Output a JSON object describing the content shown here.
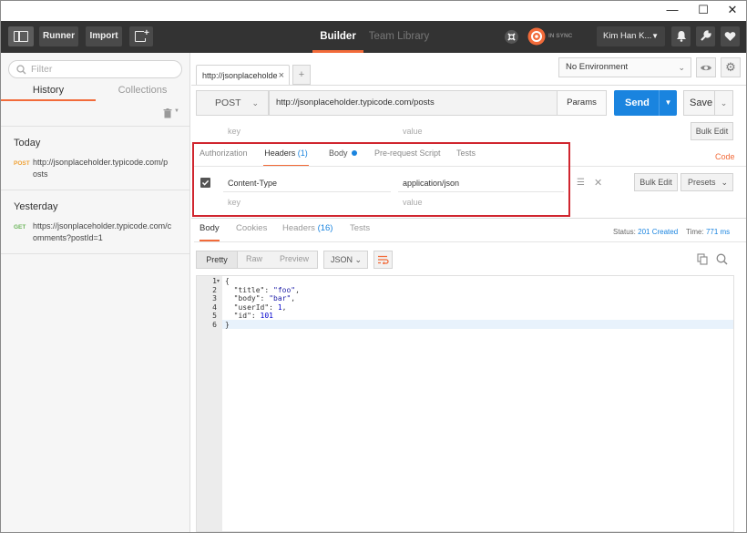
{
  "window": {
    "minimize": "—",
    "maximize": "☐",
    "close": "✕"
  },
  "header": {
    "runner": "Runner",
    "import": "Import",
    "tabs": {
      "builder": "Builder",
      "team_library": "Team Library"
    },
    "sync_status": "IN SYNC",
    "user": "Kim Han K..."
  },
  "sidebar": {
    "filter_placeholder": "Filter",
    "tabs": {
      "history": "History",
      "collections": "Collections"
    },
    "sections": [
      {
        "label": "Today",
        "method": "POST",
        "url_line1": "http://jsonplaceholder.typicode.com/p",
        "url_line2": "osts"
      },
      {
        "label": "Yesterday",
        "method": "GET",
        "url_line1": "https://jsonplaceholder.typicode.com/c",
        "url_line2": "omments?postId=1"
      }
    ]
  },
  "request_tab": {
    "label": "http://jsonplaceholde",
    "close": "×",
    "add": "+"
  },
  "environment": {
    "selected": "No Environment"
  },
  "request": {
    "method": "POST",
    "url": "http://jsonplaceholder.typicode.com/posts",
    "params": "Params",
    "send": "Send",
    "save": "Save"
  },
  "params_row": {
    "key_placeholder": "key",
    "value_placeholder": "value",
    "bulk_edit": "Bulk Edit"
  },
  "request_tabs": {
    "authorization": "Authorization",
    "headers": "Headers",
    "headers_count": "(1)",
    "body": "Body",
    "prerequest": "Pre-request Script",
    "tests": "Tests",
    "code": "Code"
  },
  "headers": {
    "rows": [
      {
        "key": "Content-Type",
        "value": "application/json"
      }
    ],
    "key_placeholder": "key",
    "value_placeholder": "value",
    "bulk_edit": "Bulk Edit",
    "presets": "Presets"
  },
  "response": {
    "tabs": {
      "body": "Body",
      "cookies": "Cookies",
      "headers": "Headers",
      "headers_count": "(16)",
      "tests": "Tests"
    },
    "status_label": "Status:",
    "status_value": "201 Created",
    "time_label": "Time:",
    "time_value": "771 ms",
    "view": {
      "pretty": "Pretty",
      "raw": "Raw",
      "preview": "Preview",
      "format": "JSON"
    }
  },
  "code_lines": {
    "n1": "1",
    "n2": "2",
    "n3": "3",
    "n4": "4",
    "n5": "5",
    "n6": "6",
    "open": "{",
    "title_key": "\"title\"",
    "title_val": "\"foo\"",
    "body_key": "\"body\"",
    "body_val": "\"bar\"",
    "userId_key": "\"userId\"",
    "userId_val": "1",
    "id_key": "\"id\"",
    "id_val": "101",
    "close": "}"
  },
  "colors": {
    "accent": "#f26b3a",
    "send": "#1a84df",
    "header_bg": "#333333",
    "highlight_box": "#d0262f"
  }
}
